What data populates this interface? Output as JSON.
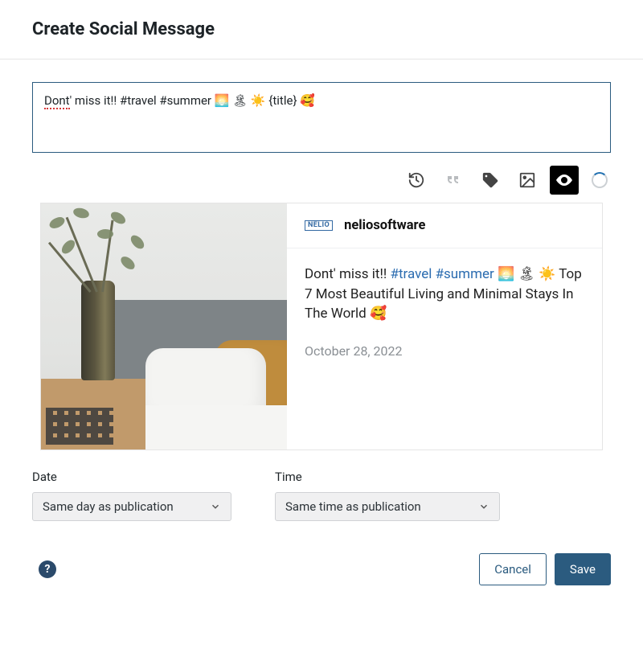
{
  "header": {
    "title": "Create Social Message"
  },
  "message": {
    "text": "Dont' miss it!! #travel #summer 🌅 🏝 ☀️ {title} 🥰",
    "misspelled_prefix": "Dont",
    "rest": "' miss it!! #travel #summer 🌅 🏝 ☀️ {title} 🥰"
  },
  "toolbar": {
    "history_icon": "history-icon",
    "quote_icon": "quote-icon",
    "tag_icon": "tag-icon",
    "image_icon": "image-icon",
    "preview_icon": "eye-icon",
    "spinner": "loading"
  },
  "preview": {
    "logo_text": "NELIO",
    "username": "neliosoftware",
    "message_plain_prefix": "Dont' miss it!! ",
    "hashtag1": "#travel",
    "hashtag2": "#summer",
    "message_emojis": " 🌅 🏝 ☀️ ",
    "title_resolved": "Top 7 Most Beautiful Living and Minimal Stays In The World 🥰",
    "date": "October 28, 2022"
  },
  "fields": {
    "date_label": "Date",
    "date_value": "Same day as publication",
    "time_label": "Time",
    "time_value": "Same time as publication"
  },
  "footer": {
    "help": "?",
    "cancel": "Cancel",
    "save": "Save"
  }
}
